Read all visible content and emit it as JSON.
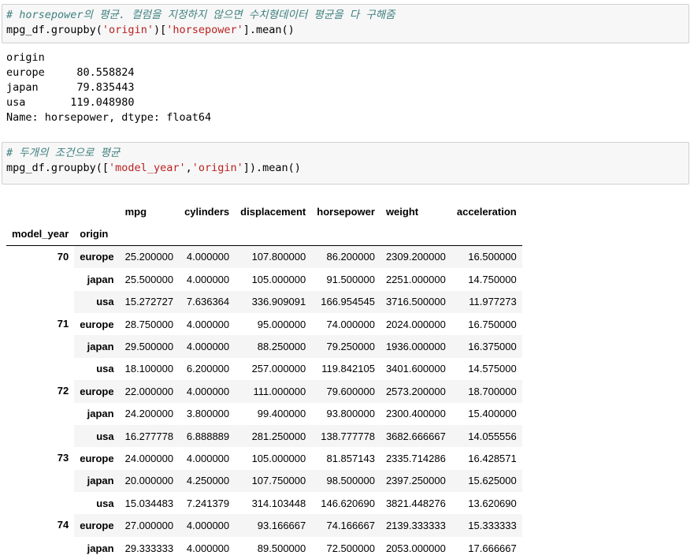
{
  "cell1": {
    "comment": "# horsepower의 평균. 컬럼을 지정하지 않으면 수치형데이터 평균을 다 구해줌",
    "code_prefix": "mpg_df.groupby(",
    "arg1": "'origin'",
    "code_mid": ")[",
    "arg2": "'horsepower'",
    "code_suffix": "].mean()"
  },
  "output1": {
    "lines": [
      "origin",
      "europe     80.558824",
      "japan      79.835443",
      "usa       119.048980",
      "Name: horsepower, dtype: float64"
    ]
  },
  "cell2": {
    "comment": "# 두개의 조건으로 평균",
    "code_prefix": "mpg_df.groupby([",
    "arg1": "'model_year'",
    "code_comma": ",",
    "arg2": "'origin'",
    "code_suffix": "]).mean()"
  },
  "table": {
    "columns": [
      "mpg",
      "cylinders",
      "displacement",
      "horsepower",
      "weight",
      "acceleration"
    ],
    "index_names": [
      "model_year",
      "origin"
    ],
    "groups": [
      {
        "year": "70",
        "rows": [
          {
            "origin": "europe",
            "values": [
              "25.200000",
              "4.000000",
              "107.800000",
              "86.200000",
              "2309.200000",
              "16.500000"
            ]
          },
          {
            "origin": "japan",
            "values": [
              "25.500000",
              "4.000000",
              "105.000000",
              "91.500000",
              "2251.000000",
              "14.750000"
            ]
          },
          {
            "origin": "usa",
            "values": [
              "15.272727",
              "7.636364",
              "336.909091",
              "166.954545",
              "3716.500000",
              "11.977273"
            ]
          }
        ]
      },
      {
        "year": "71",
        "rows": [
          {
            "origin": "europe",
            "values": [
              "28.750000",
              "4.000000",
              "95.000000",
              "74.000000",
              "2024.000000",
              "16.750000"
            ]
          },
          {
            "origin": "japan",
            "values": [
              "29.500000",
              "4.000000",
              "88.250000",
              "79.250000",
              "1936.000000",
              "16.375000"
            ]
          },
          {
            "origin": "usa",
            "values": [
              "18.100000",
              "6.200000",
              "257.000000",
              "119.842105",
              "3401.600000",
              "14.575000"
            ]
          }
        ]
      },
      {
        "year": "72",
        "rows": [
          {
            "origin": "europe",
            "values": [
              "22.000000",
              "4.000000",
              "111.000000",
              "79.600000",
              "2573.200000",
              "18.700000"
            ]
          },
          {
            "origin": "japan",
            "values": [
              "24.200000",
              "3.800000",
              "99.400000",
              "93.800000",
              "2300.400000",
              "15.400000"
            ]
          },
          {
            "origin": "usa",
            "values": [
              "16.277778",
              "6.888889",
              "281.250000",
              "138.777778",
              "3682.666667",
              "14.055556"
            ]
          }
        ]
      },
      {
        "year": "73",
        "rows": [
          {
            "origin": "europe",
            "values": [
              "24.000000",
              "4.000000",
              "105.000000",
              "81.857143",
              "2335.714286",
              "16.428571"
            ]
          },
          {
            "origin": "japan",
            "values": [
              "20.000000",
              "4.250000",
              "107.750000",
              "98.500000",
              "2397.250000",
              "15.625000"
            ]
          },
          {
            "origin": "usa",
            "values": [
              "15.034483",
              "7.241379",
              "314.103448",
              "146.620690",
              "3821.448276",
              "13.620690"
            ]
          }
        ]
      },
      {
        "year": "74",
        "rows": [
          {
            "origin": "europe",
            "values": [
              "27.000000",
              "4.000000",
              "93.166667",
              "74.166667",
              "2139.333333",
              "15.333333"
            ]
          },
          {
            "origin": "japan",
            "values": [
              "29.333333",
              "4.000000",
              "89.500000",
              "72.500000",
              "2053.000000",
              "17.666667"
            ]
          }
        ]
      }
    ]
  }
}
